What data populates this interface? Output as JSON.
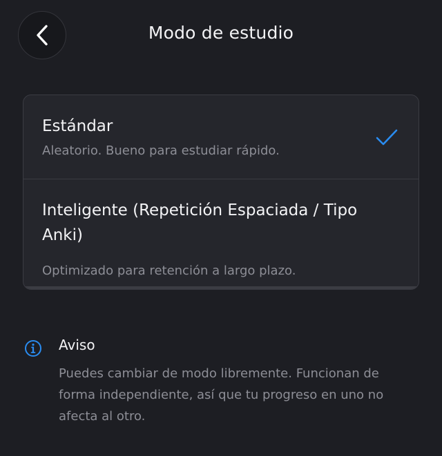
{
  "header": {
    "title": "Modo de estudio",
    "back_icon": "chevron-left-icon"
  },
  "modes": [
    {
      "title": "Estándar",
      "description": "Aleatorio. Bueno para estudiar rápido.",
      "selected": true
    },
    {
      "title": "Inteligente (Repetición Espaciada / Tipo Anki)",
      "description": "Optimizado para retención a largo plazo.",
      "selected": false
    }
  ],
  "notice": {
    "icon": "info-icon",
    "title": "Aviso",
    "text": "Puedes cambiar de modo libremente. Funcionan de forma independiente, así que tu progreso en uno no afecta al otro."
  },
  "colors": {
    "background": "#1d1e23",
    "card": "#25262c",
    "accent": "#2a8cf0",
    "text_primary": "#f3f3f5",
    "text_secondary": "#8d8e96"
  }
}
